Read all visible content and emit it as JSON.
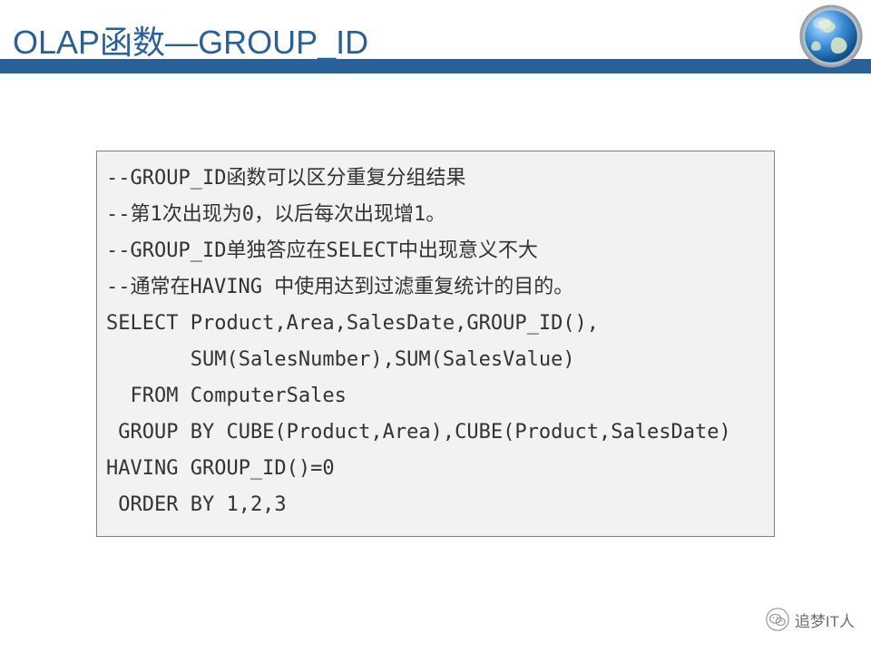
{
  "header": {
    "title_prefix": "OLAP",
    "title_middle": "函数—",
    "title_suffix": "GROUP_ID"
  },
  "code": {
    "lines": [
      "--GROUP_ID函数可以区分重复分组结果",
      "--第1次出现为0，以后每次出现增1。",
      "--GROUP_ID单独答应在SELECT中出现意义不大",
      "--通常在HAVING 中使用达到过滤重复统计的目的。",
      "SELECT Product,Area,SalesDate,GROUP_ID(),",
      "       SUM(SalesNumber),SUM(SalesValue)",
      "  FROM ComputerSales",
      " GROUP BY CUBE(Product,Area),CUBE(Product,SalesDate)",
      "HAVING GROUP_ID()=0",
      " ORDER BY 1,2,3"
    ]
  },
  "watermark": {
    "text": "追梦IT人"
  }
}
